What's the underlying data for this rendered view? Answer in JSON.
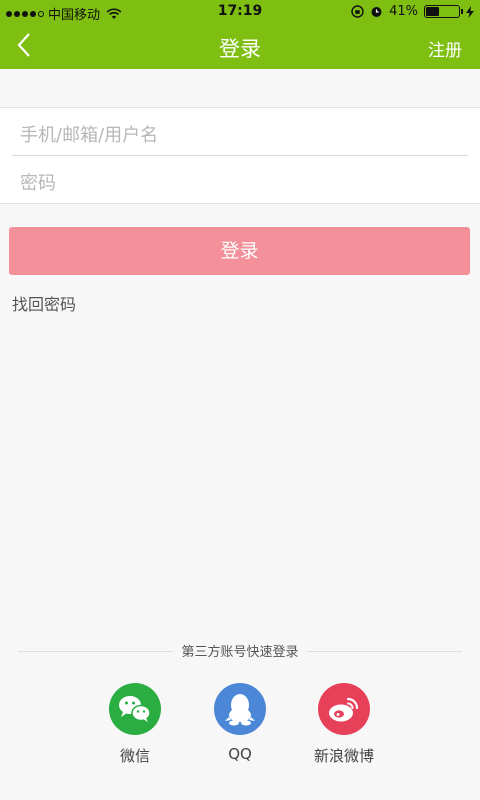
{
  "status_bar": {
    "carrier": "中国移动",
    "time": "17:19",
    "battery_percent_text": "41%",
    "battery_level": 0.41,
    "signal_bars_filled": 4,
    "signal_bars_total": 5
  },
  "header": {
    "title": "登录",
    "register_label": "注册",
    "background_color": "#7ebf11"
  },
  "form": {
    "account_placeholder": "手机/邮箱/用户名",
    "password_placeholder": "密码"
  },
  "login_button": {
    "label": "登录",
    "color": "#f3909a"
  },
  "forgot_password_label": "找回密码",
  "third_party": {
    "title": "第三方账号快速登录",
    "providers": [
      {
        "label": "微信",
        "icon": "wechat-icon",
        "color": "#2aae42"
      },
      {
        "label": "QQ",
        "icon": "qq-icon",
        "color": "#4b87d6"
      },
      {
        "label": "新浪微博",
        "icon": "weibo-icon",
        "color": "#e7415a"
      }
    ]
  }
}
